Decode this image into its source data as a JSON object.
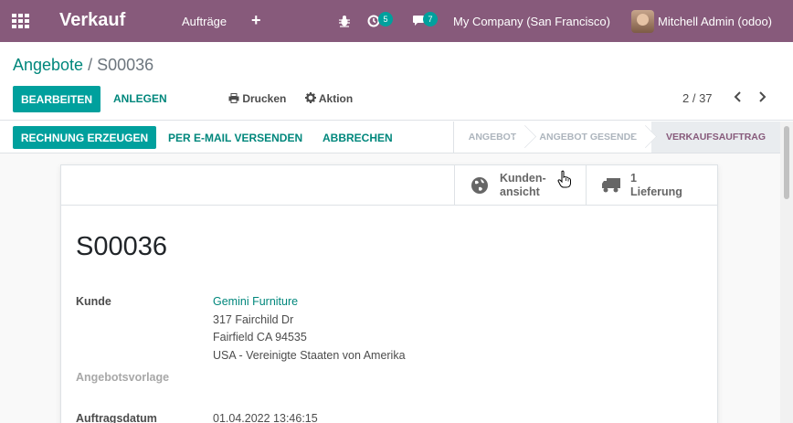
{
  "navbar": {
    "app_name": "Verkauf",
    "menu_orders": "Aufträge",
    "add_symbol": "+",
    "activity_badge": "5",
    "messages_badge": "7",
    "company": "My Company (San Francisco)",
    "user": "Mitchell Admin (odoo)",
    "bar_color": "#875a7b"
  },
  "breadcrumb": {
    "parent": "Angebote",
    "separator": "/",
    "current": "S00036"
  },
  "control": {
    "edit_label": "BEARBEITEN",
    "create_label": "ANLEGEN",
    "print_label": "Drucken",
    "action_label": "Aktion",
    "pager_value": "2 / 37"
  },
  "statusbar": {
    "invoice_button": "RECHNUNG ERZEUGEN",
    "email_button": "PER E-MAIL VERSENDEN",
    "cancel_button": "ABBRECHEN",
    "steps": [
      "ANGEBOT",
      "ANGEBOT GESENDET",
      "VERKAUFSAUFTRAG"
    ],
    "active_step": "VERKAUFSAUFTRAG"
  },
  "smart_buttons": {
    "customer_preview_line1": "Kunden-",
    "customer_preview_line2": "ansicht",
    "delivery_count": "1",
    "delivery_label": "Lieferung"
  },
  "form": {
    "title": "S00036",
    "customer_label": "Kunde",
    "customer_name": "Gemini Furniture",
    "address_line1": "317 Fairchild Dr",
    "address_line2": "Fairfield CA 94535",
    "address_line3": "USA - Vereinigte Staaten von Amerika",
    "template_label": "Angebotsvorlage",
    "order_date_label": "Auftragsdatum",
    "order_date_value": "01.04.2022 13:46:15"
  },
  "colors": {
    "primary": "#00a09d",
    "link": "#00877c",
    "brand": "#875a7b"
  }
}
